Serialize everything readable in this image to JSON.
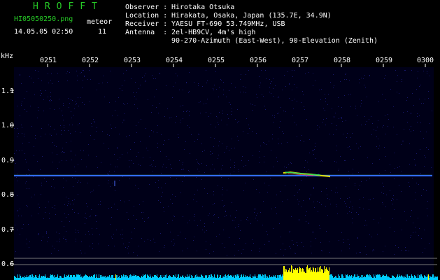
{
  "header": {
    "brand": "HROFFT",
    "filename": "HI05050250.png",
    "datetime": "14.05.05 02:50",
    "meteor_label": "meteor",
    "meteor_count": "11"
  },
  "info": {
    "observer_key": "Observer :",
    "observer_val": "Hirotaka Otsuka",
    "location_key": "Location :",
    "location_val": "Hirakata, Osaka, Japan (135.7E, 34.9N)",
    "receiver_key": "Receiver :",
    "receiver_val": "YAESU FT-690 53.749MHz, USB",
    "antenna_key": "Antenna  :",
    "antenna_val": "2el-HB9CV, 4m's high",
    "antenna_val2": "90-270-Azimuth (East-West), 90-Elevation (Zenith)"
  },
  "axis": {
    "unit": "kHz",
    "time_labels": [
      "0251",
      "0252",
      "0253",
      "0254",
      "0255",
      "0256",
      "0257",
      "0258",
      "0259",
      "0300"
    ],
    "freq_labels": [
      "1.1",
      "1.0",
      "0.9",
      "0.8",
      "0.7",
      "0.6"
    ]
  },
  "colors": {
    "carrier": "#2b5fff",
    "echo": "#e7e200",
    "meter": "#00ccff",
    "meter_peak": "#ffff00",
    "grid_dot": "#16166a"
  }
}
